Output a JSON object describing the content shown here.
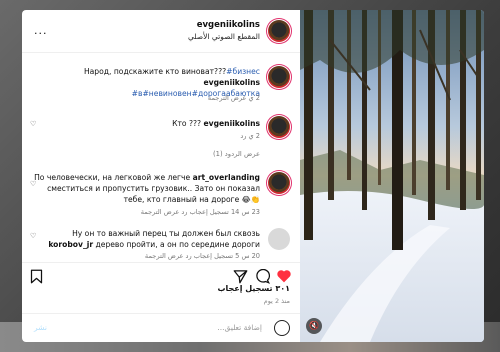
{
  "header": {
    "username": "evgeniikolins",
    "subtitle": "المقطع الصوتي الأصلي",
    "more_label": "..."
  },
  "caption": {
    "username": "evgeniikolins",
    "text": "Народ, подскажите кто виноват???",
    "hashtags_line1": "#бизнес",
    "hashtags_line2": "#в#невиновен#дорогаабаютка",
    "meta": "2 ي   عرض الترجمة"
  },
  "comments": [
    {
      "username": "evgeniikolins",
      "text": "Кто ???",
      "meta": "2 ي   رد",
      "replies_label": "عرض الردود (1)"
    },
    {
      "username": "art_overlanding",
      "text_pre": "По человечески, на легковой же легче ",
      "text_post": "сместиться и пропустить грузовик.. Зато он показал тебе, кто главный на дороге 😂👏",
      "meta": "23 س   14 تسجيل إعجاب   رد   عرض الترجمة"
    },
    {
      "username": "korobov_jr",
      "text_pre": "Ну он то важный перец ты должен был сквозь ",
      "text_post": "дерево пройти, а он по середине дороги",
      "meta": "20 س   5 تسجيل إعجاب   رد   عرض الترجمة"
    }
  ],
  "likes": "٣٠١ تسجيل إعجاب",
  "time_ago": "منذ 2 يوم",
  "composer": {
    "placeholder": "إضافة تعليق...",
    "post_label": "نشر"
  },
  "colors": {
    "like_red": "#ff3040",
    "link_blue": "#2a5db0",
    "post_blue": "#b2dffc",
    "avatar_ring": "#e1306c"
  },
  "icons": [
    "more-icon",
    "heart-outline-icon",
    "heart-filled-icon",
    "comment-icon",
    "share-icon",
    "bookmark-icon",
    "emoji-icon",
    "mute-icon"
  ]
}
